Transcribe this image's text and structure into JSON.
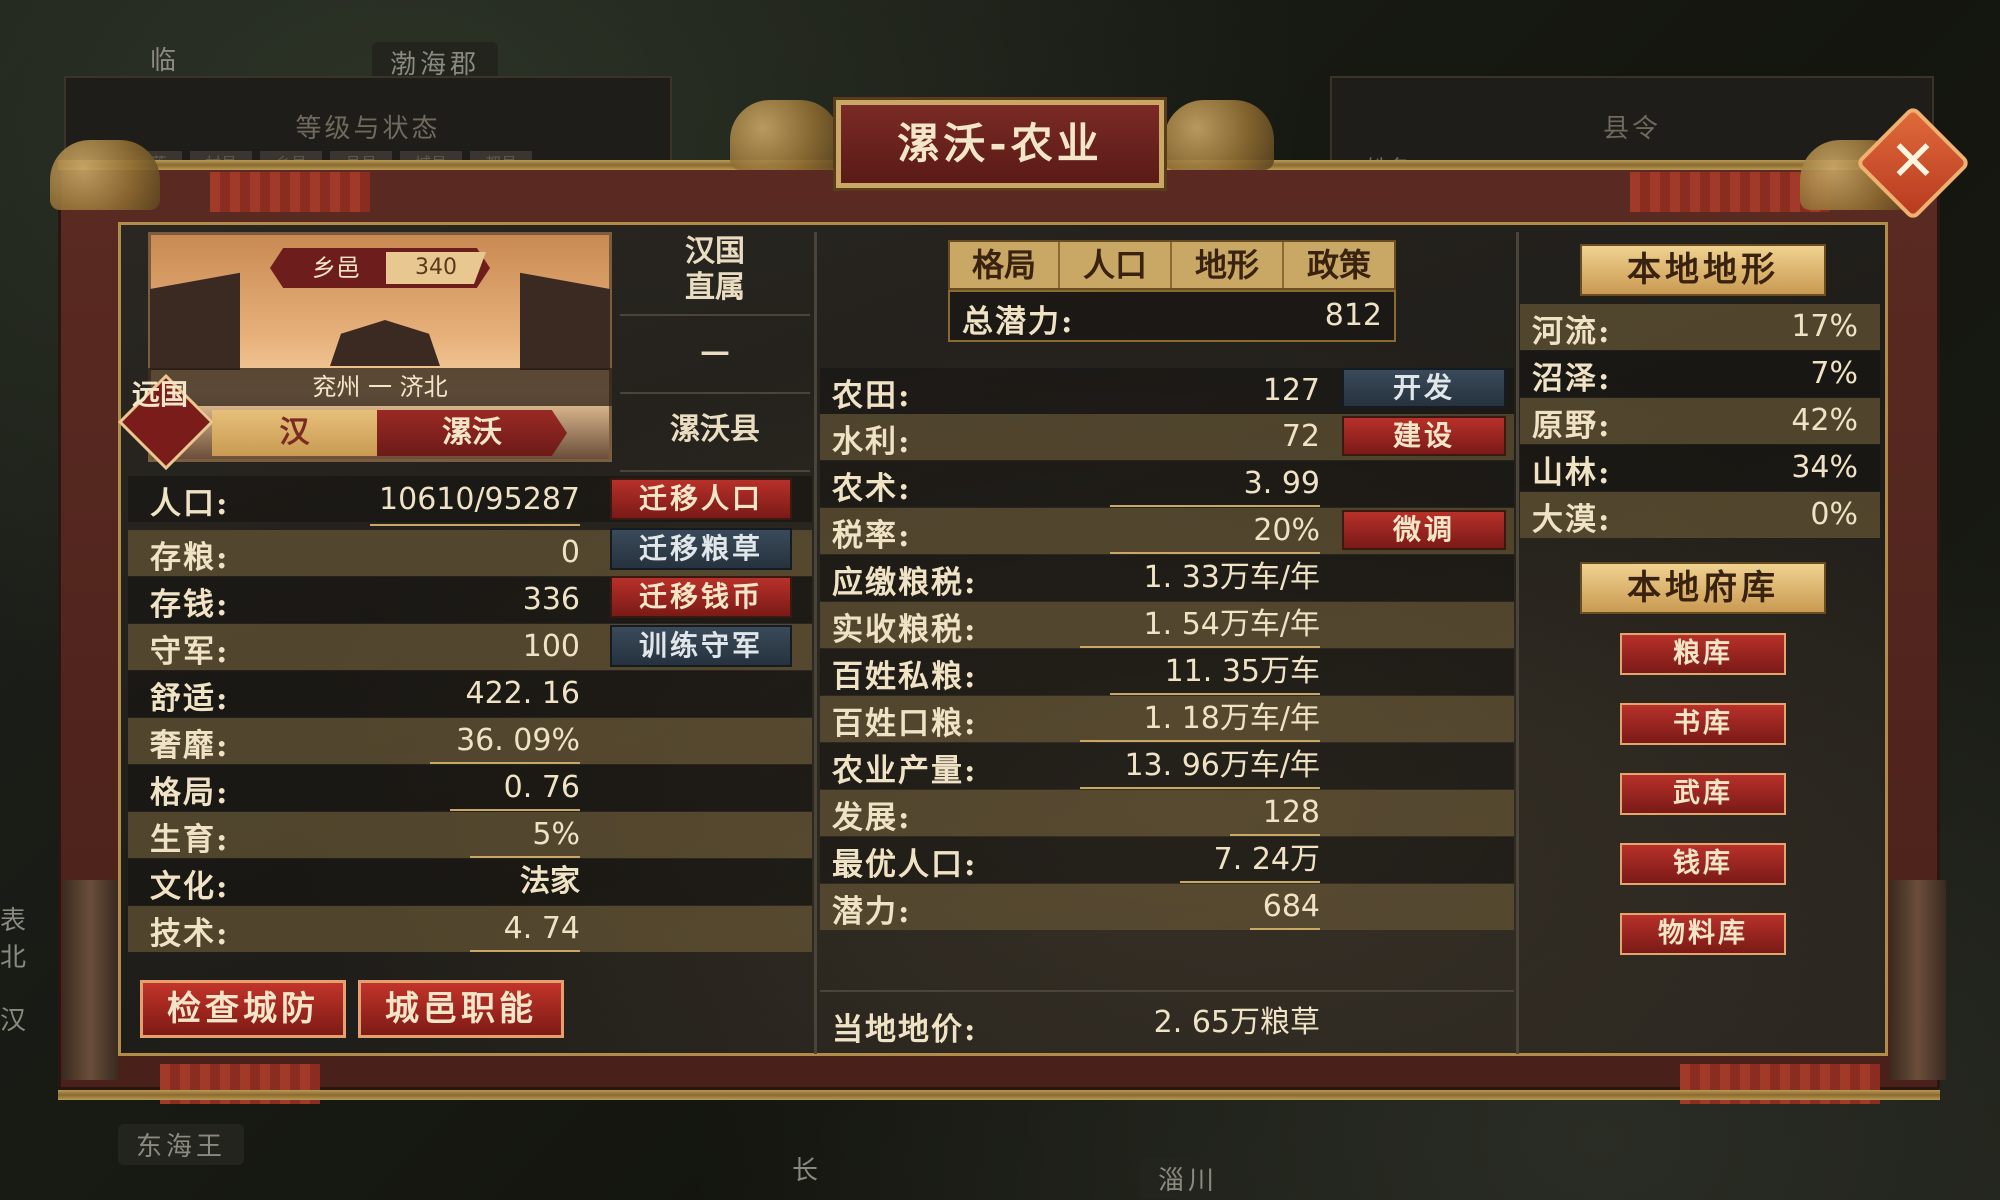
{
  "window_title": "漯沃-农业",
  "background": {
    "map_labels": [
      "临",
      "渤海郡",
      "东海王",
      "长",
      "淄川",
      "表北",
      "汉"
    ],
    "back_left_header": "等级与状态",
    "back_left_chips": [
      "聚落",
      "村邑",
      "乡邑",
      "县邑",
      "城邑",
      "都邑"
    ],
    "back_right_header": "县令",
    "back_right_name_label": "姓名: -"
  },
  "city": {
    "rank_label": "乡邑",
    "rank_value": "340",
    "location": "兖州 一 济北",
    "badge": "远国",
    "kingdom": "汉",
    "name": "漯沃"
  },
  "info_column": {
    "affiliation": "汉国\n直属",
    "dash": "—",
    "county": "漯沃县"
  },
  "stats": [
    {
      "label": "人口:",
      "value": "10610/95287"
    },
    {
      "label": "存粮:",
      "value": "0"
    },
    {
      "label": "存钱:",
      "value": "336"
    },
    {
      "label": "守军:",
      "value": "100"
    },
    {
      "label": "舒适:",
      "value": "422. 16"
    },
    {
      "label": "奢靡:",
      "value": "36. 09%"
    },
    {
      "label": "格局:",
      "value": "0. 76"
    },
    {
      "label": "生育:",
      "value": "5%"
    },
    {
      "label": "文化:",
      "value": "法家"
    },
    {
      "label": "技术:",
      "value": "4. 74"
    }
  ],
  "stat_actions": [
    "迁移人口",
    "迁移粮草",
    "迁移钱币",
    "训练守军"
  ],
  "bottom_buttons": [
    "检查城防",
    "城邑职能"
  ],
  "tabs": [
    "格局",
    "人口",
    "地形",
    "政策"
  ],
  "total_potential": {
    "label": "总潜力:",
    "value": "812"
  },
  "agri_rows": [
    {
      "label": "农田:",
      "value": "127",
      "action": "开发",
      "action_style": "blue"
    },
    {
      "label": "水利:",
      "value": "72",
      "action": "建设",
      "action_style": "red"
    },
    {
      "label": "农术:",
      "value": "3. 99"
    },
    {
      "label": "税率:",
      "value": "20%",
      "action": "微调",
      "action_style": "red"
    },
    {
      "label": "应缴粮税:",
      "value": "1. 33万车/年"
    },
    {
      "label": "实收粮税:",
      "value": "1. 54万车/年"
    },
    {
      "label": "百姓私粮:",
      "value": "11. 35万车"
    },
    {
      "label": "百姓口粮:",
      "value": "1. 18万车/年"
    },
    {
      "label": "农业产量:",
      "value": "13. 96万车/年"
    },
    {
      "label": "发展:",
      "value": "128"
    },
    {
      "label": "最优人口:",
      "value": "7. 24万"
    },
    {
      "label": "潜力:",
      "value": "684"
    }
  ],
  "land_price": {
    "label": "当地地价:",
    "value": "2. 65万粮草"
  },
  "terrain": {
    "header": "本地地形",
    "rows": [
      {
        "label": "河流:",
        "value": "17%"
      },
      {
        "label": "沼泽:",
        "value": "7%"
      },
      {
        "label": "原野:",
        "value": "42%"
      },
      {
        "label": "山林:",
        "value": "34%"
      },
      {
        "label": "大漠:",
        "value": "0%"
      }
    ]
  },
  "storehouse": {
    "header": "本地府库",
    "buttons": [
      "粮库",
      "书库",
      "武库",
      "钱库",
      "物料库"
    ]
  }
}
